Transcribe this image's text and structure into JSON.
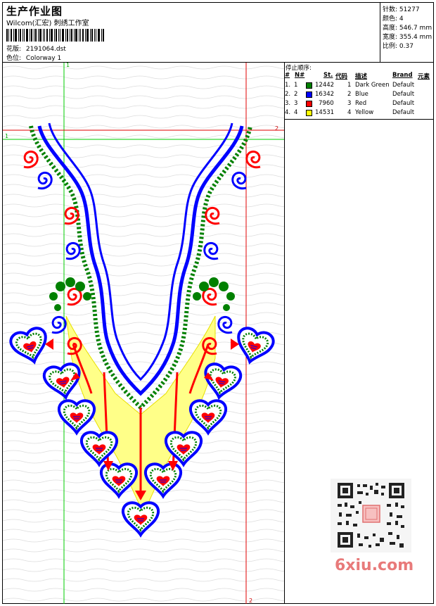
{
  "header": {
    "title": "生产作业图",
    "company": "Wilcom(汇宏) 刺绣工作室",
    "design_file_label": "花版:",
    "design_file": "2191064.dst",
    "colorway_label": "色位:",
    "colorway": "Colorway 1"
  },
  "stats": [
    {
      "label": "针数:",
      "value": "51277"
    },
    {
      "label": "颜色:",
      "value": "4"
    },
    {
      "label": "高度:",
      "value": "546.7 mm"
    },
    {
      "label": "宽度:",
      "value": "355.4 mm"
    },
    {
      "label": "比例:",
      "value": "0.37"
    }
  ],
  "legend": {
    "title": "停止顺序:",
    "headers": {
      "num": "#",
      "n": "N#",
      "st": "St.",
      "code": "代码",
      "desc": "描述",
      "brand": "Brand",
      "elem": "元素"
    },
    "rows": [
      {
        "num": "1.",
        "n": "1",
        "st": "12442",
        "code": "1",
        "desc": "Dark Green",
        "brand": "Default",
        "color": "#008000"
      },
      {
        "num": "2.",
        "n": "2",
        "st": "16342",
        "code": "2",
        "desc": "Blue",
        "brand": "Default",
        "color": "#0000ff"
      },
      {
        "num": "3.",
        "n": "3",
        "st": "7960",
        "code": "3",
        "desc": "Red",
        "brand": "Default",
        "color": "#ff0000"
      },
      {
        "num": "4.",
        "n": "4",
        "st": "14531",
        "code": "4",
        "desc": "Yellow",
        "brand": "Default",
        "color": "#ffff00"
      }
    ]
  },
  "guides": {
    "v1": "1",
    "h1": "1",
    "h2": "2",
    "v2": "2"
  },
  "watermark": "6xiu.com",
  "colors": {
    "green": "#008000",
    "blue": "#0000ff",
    "red": "#ff0000",
    "yellow": "#ffff66"
  }
}
